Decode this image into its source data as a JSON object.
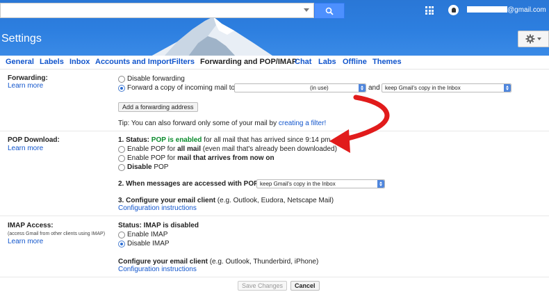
{
  "header": {
    "settings_title": "Settings",
    "email_suffix": "@gmail.com"
  },
  "tabs": [
    {
      "label": "General"
    },
    {
      "label": "Labels"
    },
    {
      "label": "Inbox"
    },
    {
      "label": "Accounts and Import"
    },
    {
      "label": "Filters"
    },
    {
      "label": "Forwarding and POP/IMAP"
    },
    {
      "label": "Chat"
    },
    {
      "label": "Labs"
    },
    {
      "label": "Offline"
    },
    {
      "label": "Themes"
    }
  ],
  "forwarding": {
    "label": "Forwarding:",
    "learn_more": "Learn more",
    "disable": "Disable forwarding",
    "forward_copy": "Forward a copy of incoming mail to",
    "address_select": "(in use)",
    "and": "and",
    "action_select": "keep Gmail's copy in the Inbox",
    "add_button": "Add a forwarding address",
    "tip_prefix": "Tip: You can also forward only some of your mail by ",
    "tip_link": "creating a filter!"
  },
  "pop": {
    "label": "POP Download:",
    "learn_more": "Learn more",
    "status_prefix": "1. Status: ",
    "status_value": "POP is enabled",
    "status_suffix": " for all mail that has arrived since 9:14 pm",
    "opt_all_prefix": "Enable POP for ",
    "opt_all_bold": "all mail",
    "opt_all_suffix": " (even mail that's already been downloaded)",
    "opt_now_prefix": "Enable POP for ",
    "opt_now_bold": "mail that arrives from now on",
    "opt_disable_bold": "Disable",
    "opt_disable_suffix": " POP",
    "accessed_label": "2. When messages are accessed with POP",
    "accessed_select": "keep Gmail's copy in the Inbox",
    "configure_bold": "3. Configure your email client",
    "configure_hint": " (e.g. Outlook, Eudora, Netscape Mail)",
    "config_link": "Configuration instructions"
  },
  "imap": {
    "label": "IMAP Access:",
    "sublabel": "(access Gmail from other clients using IMAP)",
    "learn_more": "Learn more",
    "status": "Status: IMAP is disabled",
    "enable": "Enable IMAP",
    "disable": "Disable IMAP",
    "configure_bold": "Configure your email client",
    "configure_hint": " (e.g. Outlook, Thunderbird, iPhone)",
    "config_link": "Configuration instructions"
  },
  "footer": {
    "save": "Save Changes",
    "cancel": "Cancel"
  },
  "colors": {
    "header_blue": "#2d7fe0",
    "link": "#1155cc",
    "status_green": "#0a8a2c",
    "annotation_red": "#e11b1b"
  }
}
